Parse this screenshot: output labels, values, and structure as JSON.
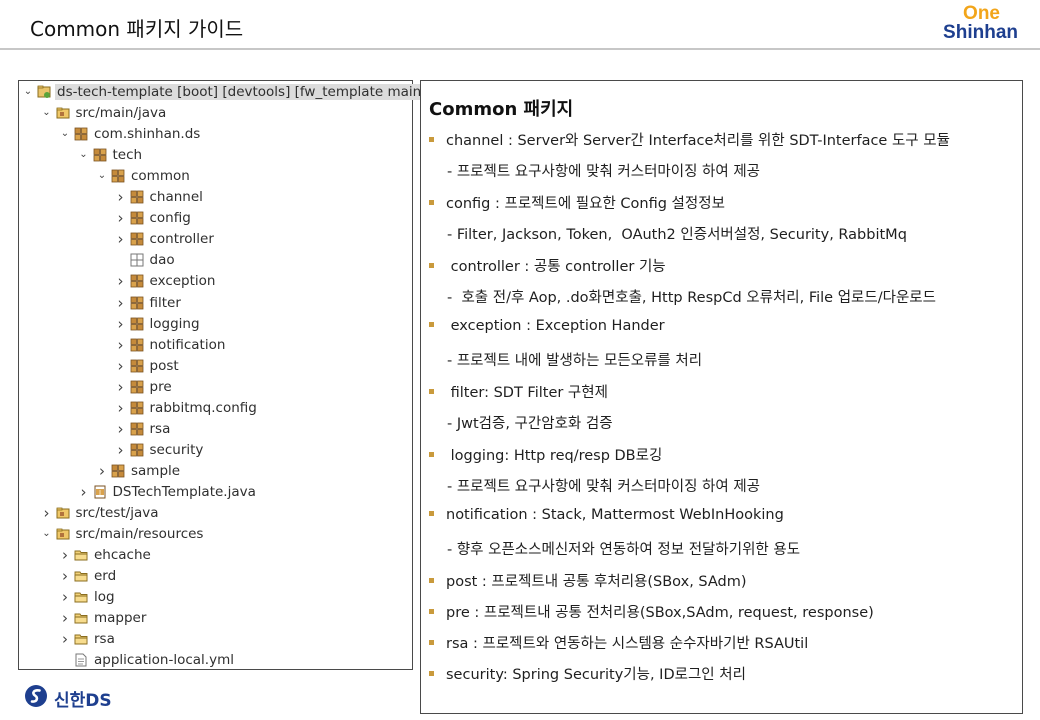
{
  "header": {
    "title": "Common 패키지 가이드"
  },
  "brand": {
    "line1": "One",
    "line2": "Shinhan"
  },
  "footer": {
    "logo_text": "신한DS"
  },
  "tree": {
    "items": [
      {
        "label": "ds-tech-template [boot] [devtools] [fw_template main]",
        "chevron": "expanded",
        "icon": "project-icon",
        "selected": true
      },
      {
        "label": "src/main/java",
        "chevron": "expanded",
        "icon": "source-folder-icon"
      },
      {
        "label": "com.shinhan.ds",
        "chevron": "expanded",
        "icon": "package-icon"
      },
      {
        "label": "tech",
        "chevron": "expanded",
        "icon": "package-icon"
      },
      {
        "label": "common",
        "chevron": "expanded",
        "icon": "package-icon"
      },
      {
        "label": "channel",
        "chevron": "collapsed",
        "icon": "package-icon"
      },
      {
        "label": "config",
        "chevron": "collapsed",
        "icon": "package-icon"
      },
      {
        "label": "controller",
        "chevron": "collapsed",
        "icon": "package-icon"
      },
      {
        "label": "dao",
        "chevron": "none",
        "icon": "empty-package-icon"
      },
      {
        "label": "exception",
        "chevron": "collapsed",
        "icon": "package-icon"
      },
      {
        "label": "filter",
        "chevron": "collapsed",
        "icon": "package-icon"
      },
      {
        "label": "logging",
        "chevron": "collapsed",
        "icon": "package-icon"
      },
      {
        "label": "notification",
        "chevron": "collapsed",
        "icon": "package-icon"
      },
      {
        "label": "post",
        "chevron": "collapsed",
        "icon": "package-icon"
      },
      {
        "label": "pre",
        "chevron": "collapsed",
        "icon": "package-icon"
      },
      {
        "label": "rabbitmq.config",
        "chevron": "collapsed",
        "icon": "package-icon"
      },
      {
        "label": "rsa",
        "chevron": "collapsed",
        "icon": "package-icon"
      },
      {
        "label": "security",
        "chevron": "collapsed",
        "icon": "package-icon"
      },
      {
        "label": "sample",
        "chevron": "collapsed",
        "icon": "package-icon"
      },
      {
        "label": "DSTechTemplate.java",
        "chevron": "collapsed",
        "icon": "java-file-icon"
      },
      {
        "label": "src/test/java",
        "chevron": "collapsed",
        "icon": "source-folder-icon"
      },
      {
        "label": "src/main/resources",
        "chevron": "expanded",
        "icon": "source-folder-icon"
      },
      {
        "label": "ehcache",
        "chevron": "collapsed",
        "icon": "folder-icon"
      },
      {
        "label": "erd",
        "chevron": "collapsed",
        "icon": "folder-icon"
      },
      {
        "label": "log",
        "chevron": "collapsed",
        "icon": "folder-icon"
      },
      {
        "label": "mapper",
        "chevron": "collapsed",
        "icon": "folder-icon"
      },
      {
        "label": "rsa",
        "chevron": "collapsed",
        "icon": "folder-icon"
      },
      {
        "label": "application-local.yml",
        "chevron": "none",
        "icon": "yml-file-icon"
      }
    ]
  },
  "info": {
    "title": "Common 패키지",
    "items": [
      {
        "text": "channel : Server와 Server간 Interface처리를 위한 SDT-Interface 도구 모듈",
        "sub": "- 프로젝트 요구사항에 맞춰 커스터마이징 하여 제공"
      },
      {
        "text": "config : 프로젝트에 필요한 Config 설정정보",
        "sub": "- Filter, Jackson, Token,  OAuth2 인증서버설정, Security, RabbitMq"
      },
      {
        "text": " controller : 공통 controller 기능",
        "sub": "-  호출 전/후 Aop, .do화면호출, Http RespCd 오류처리, File 업로드/다운로드"
      },
      {
        "text": " exception : Exception Hander",
        "sub": "- 프로젝트 내에 발생하는 모든오류를 처리"
      },
      {
        "text": " filter: SDT Filter 구현제",
        "sub": "- Jwt검증, 구간암호화 검증"
      },
      {
        "text": " logging: Http req/resp DB로깅",
        "sub": "- 프로젝트 요구사항에 맞춰 커스터마이징 하여 제공"
      },
      {
        "text": "notification : Stack, Mattermost WebInHooking",
        "sub": "- 향후 오픈소스메신저와 연동하여 정보 전달하기위한 용도"
      },
      {
        "text": "post : 프로젝트내 공통 후처리용(SBox, SAdm)",
        "sub": ""
      },
      {
        "text": "pre : 프로젝트내 공통 전처리용(SBox,SAdm, request, response)",
        "sub": ""
      },
      {
        "text": "rsa : 프로젝트와 연동하는 시스템용 순수자바기반 RSAUtil",
        "sub": ""
      },
      {
        "text": "security: Spring Security기능, ID로그인 처리",
        "sub": ""
      }
    ]
  },
  "colors": {
    "brand_blue": "#1e3f8f",
    "brand_orange": "#f2a51a",
    "bullet": "#c99a3c"
  }
}
